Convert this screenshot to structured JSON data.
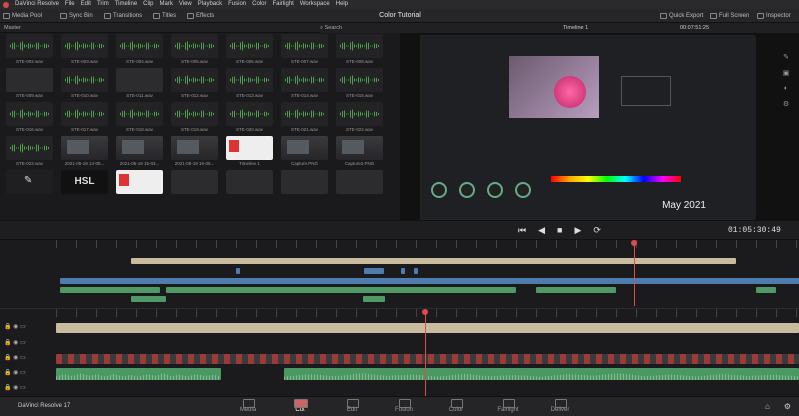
{
  "menubar": {
    "items": [
      "DaVinci Resolve",
      "File",
      "Edit",
      "Trim",
      "Timeline",
      "Clip",
      "Mark",
      "View",
      "Playback",
      "Fusion",
      "Color",
      "Fairlight",
      "Workspace",
      "Help"
    ]
  },
  "toolbar": {
    "media_pool": "Media Pool",
    "sync_bin": "Sync Bin",
    "transitions": "Transitions",
    "titles": "Titles",
    "effects": "Effects",
    "title": "Color Tutorial",
    "quick_export": "Quick Export",
    "full_screen": "Full Screen",
    "inspector": "Inspector"
  },
  "pool": {
    "bin": "Master",
    "search": "Search"
  },
  "clips": [
    {
      "name": "STE-002.wav",
      "kind": "wave"
    },
    {
      "name": "STE-003.wav",
      "kind": "wave"
    },
    {
      "name": "STE-004.wav",
      "kind": "wave"
    },
    {
      "name": "STE-005.wav",
      "kind": "wave"
    },
    {
      "name": "STE-006.wav",
      "kind": "wave"
    },
    {
      "name": "STE-007.wav",
      "kind": "wave"
    },
    {
      "name": "STE-008.wav",
      "kind": "wave"
    },
    {
      "name": "STE-009.wav",
      "kind": "dark"
    },
    {
      "name": "STE-010.wav",
      "kind": "wave"
    },
    {
      "name": "STE-011.wav",
      "kind": "dark"
    },
    {
      "name": "STE-012.wav",
      "kind": "wave"
    },
    {
      "name": "STE-013.wav",
      "kind": "wave"
    },
    {
      "name": "STE-014.wav",
      "kind": "wave"
    },
    {
      "name": "STE-015.wav",
      "kind": "wave"
    },
    {
      "name": "STE-016.wav",
      "kind": "wave"
    },
    {
      "name": "STE-017.wav",
      "kind": "wave"
    },
    {
      "name": "STE-018.wav",
      "kind": "wave"
    },
    {
      "name": "STE-019.wav",
      "kind": "wave"
    },
    {
      "name": "STE-020.wav",
      "kind": "wave"
    },
    {
      "name": "STE-021.wav",
      "kind": "wave"
    },
    {
      "name": "STE-022.wav",
      "kind": "wave"
    },
    {
      "name": "STE-023.wav",
      "kind": "wave"
    },
    {
      "name": "2021-05-19 14-08...",
      "kind": "shot"
    },
    {
      "name": "2021-05-19 15-03...",
      "kind": "shot"
    },
    {
      "name": "2021-05-19 15-05...",
      "kind": "shot"
    },
    {
      "name": "Timeline 1",
      "kind": "red"
    },
    {
      "name": "Capture.PNG",
      "kind": "shot"
    },
    {
      "name": "Capture2.PNG",
      "kind": "shot"
    },
    {
      "name": "",
      "kind": "pin"
    },
    {
      "name": "",
      "kind": "hsl",
      "text": "HSL"
    },
    {
      "name": "",
      "kind": "red"
    },
    {
      "name": "",
      "kind": "dark"
    },
    {
      "name": "",
      "kind": "dark"
    },
    {
      "name": "",
      "kind": "dark"
    },
    {
      "name": "",
      "kind": "dark"
    }
  ],
  "viewer": {
    "timeline": "Timeline 1",
    "timecode_top": "00:07:51:25",
    "overlay": "May 2021"
  },
  "transport": {
    "timecode": "01:05:30:49"
  },
  "pagebar": {
    "app": "DaVinci Resolve 17",
    "pages": [
      "Media",
      "Cut",
      "Edit",
      "Fusion",
      "Color",
      "Fairlight",
      "Deliver"
    ],
    "active": "Cut"
  }
}
